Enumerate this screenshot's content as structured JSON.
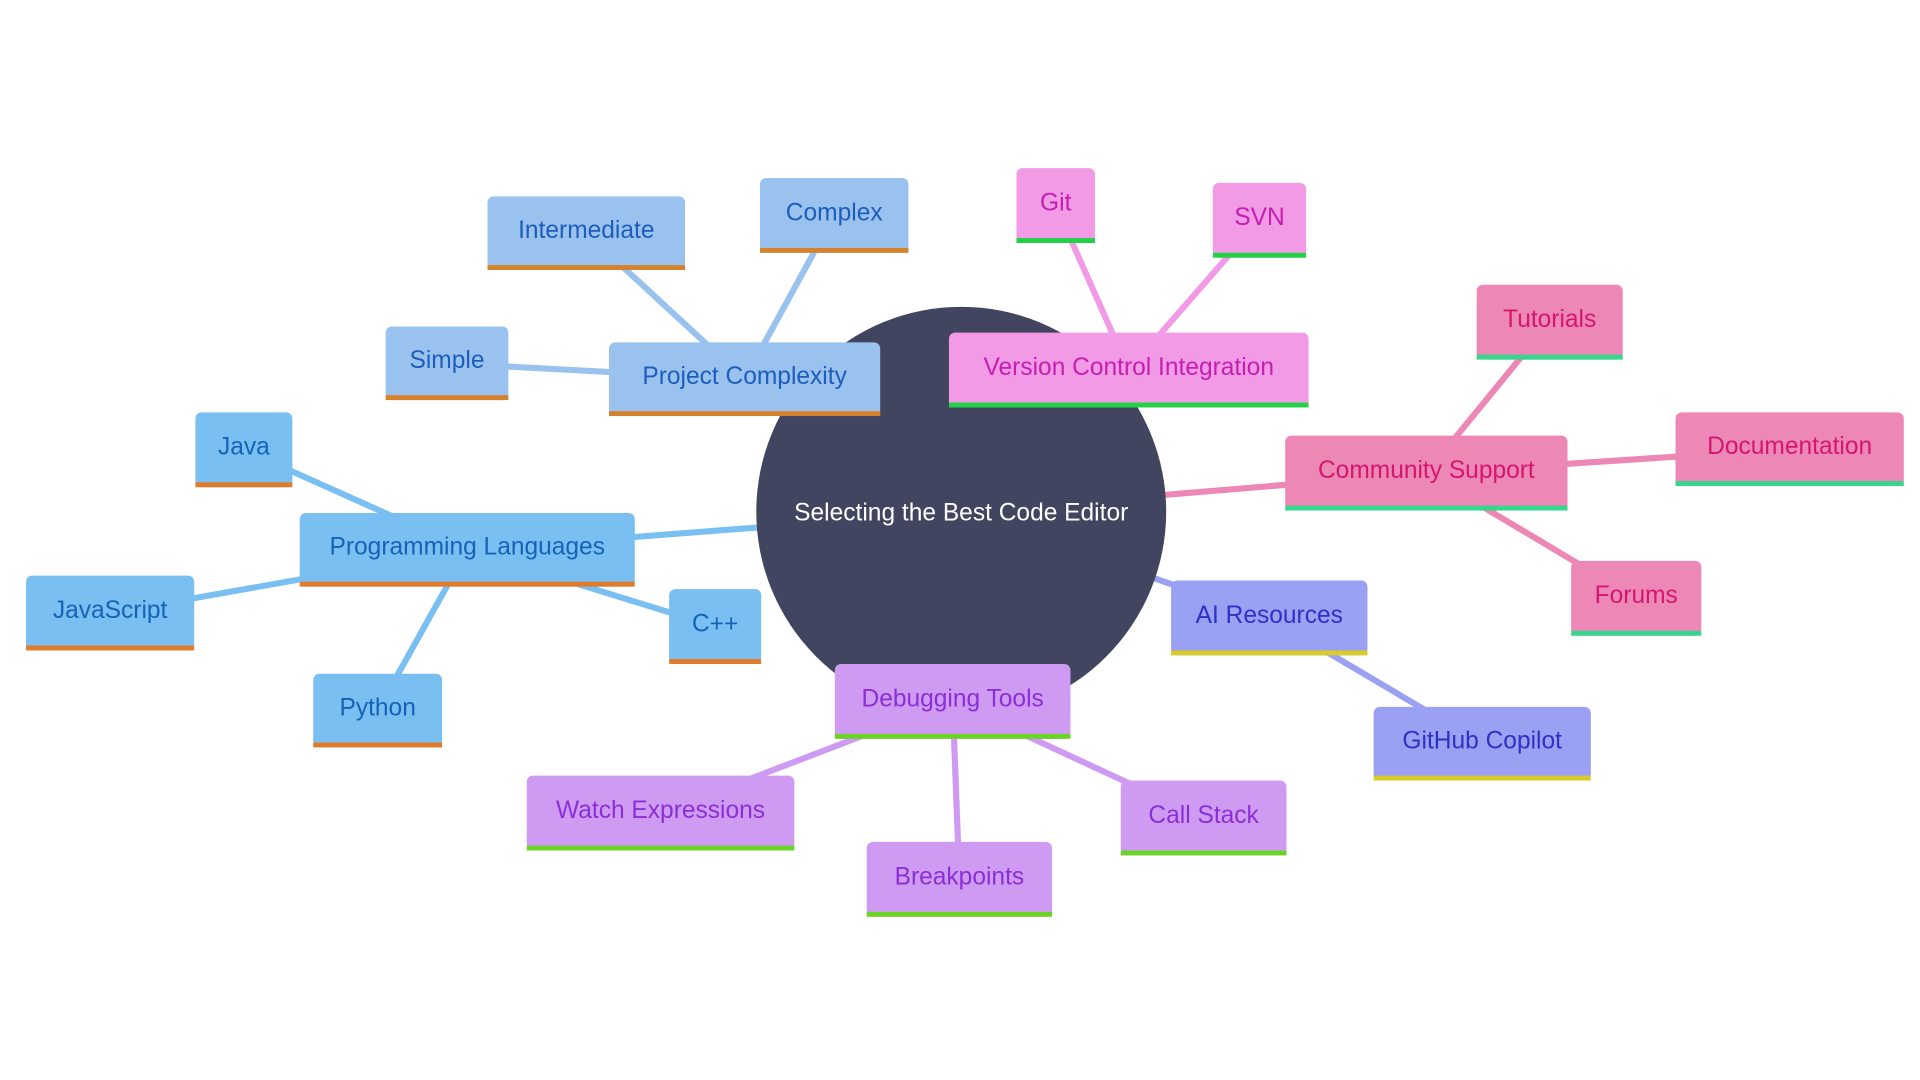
{
  "title": "Selecting the Best Code Editor",
  "root": {
    "label": "Selecting the Best Code Editor",
    "color": "#424560",
    "text_color": "#ffffff"
  },
  "branches": [
    {
      "id": "project-complexity",
      "label": "Project Complexity",
      "fill": "#9ac2ef",
      "text": "#1e5dbb",
      "accent": "#d6822d",
      "edge": "#9ac2ef",
      "children": [
        "Intermediate",
        "Complex",
        "Simple"
      ]
    },
    {
      "id": "programming-languages",
      "label": "Programming Languages",
      "fill": "#7abff2",
      "text": "#1463b7",
      "accent": "#e07b2c",
      "edge": "#7abff2",
      "children": [
        "Java",
        "JavaScript",
        "Python",
        "C++"
      ]
    },
    {
      "id": "version-control-integration",
      "label": "Version Control Integration",
      "fill": "#f29ae6",
      "text": "#c41fb0",
      "accent": "#21d246",
      "edge": "#f29ae6",
      "children": [
        "Git",
        "SVN"
      ]
    },
    {
      "id": "community-support",
      "label": "Community Support",
      "fill": "#ec87b6",
      "text": "#d6166d",
      "accent": "#35d68d",
      "edge": "#ec87b6",
      "children": [
        "Tutorials",
        "Documentation",
        "Forums"
      ]
    },
    {
      "id": "ai-resources",
      "label": "AI Resources",
      "fill": "#9aa0f2",
      "text": "#2d32c4",
      "accent": "#d9cc2a",
      "edge": "#9aa0f2",
      "children": [
        "GitHub Copilot"
      ]
    },
    {
      "id": "debugging-tools",
      "label": "Debugging Tools",
      "fill": "#cf9bf2",
      "text": "#8a2fd6",
      "accent": "#6ad425",
      "edge": "#cf9bf2",
      "children": [
        "Watch Expressions",
        "Breakpoints",
        "Call Stack"
      ]
    }
  ]
}
